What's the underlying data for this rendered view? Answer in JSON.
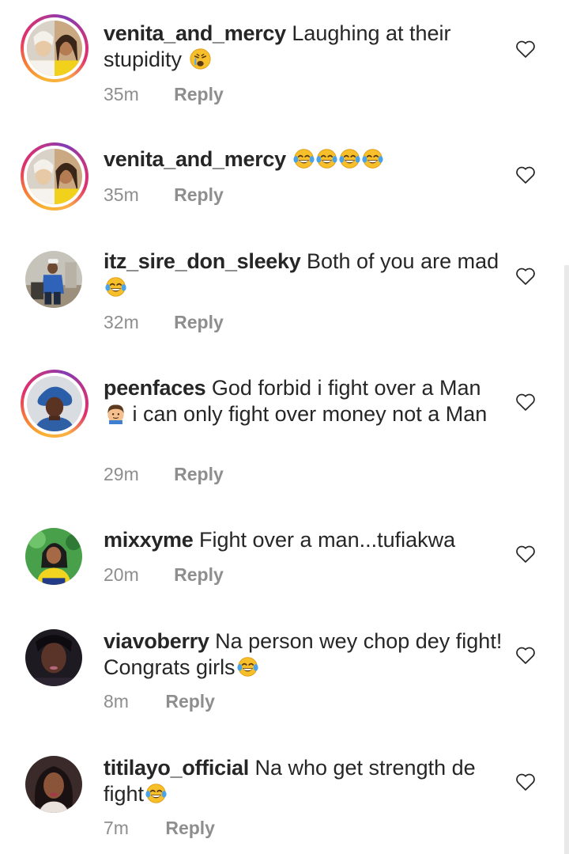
{
  "comments": [
    {
      "username": "venita_and_mercy",
      "text": "Laughing at their stupidity",
      "emoji": "weary-face",
      "time": "35m",
      "reply_label": "Reply",
      "avatar": "duo-women",
      "has_story": true
    },
    {
      "username": "venita_and_mercy",
      "text": "",
      "emoji": "tears-of-joy-x4",
      "time": "35m",
      "reply_label": "Reply",
      "avatar": "duo-women",
      "has_story": true
    },
    {
      "username": "itz_sire_don_sleeky",
      "text": "Both of you are mad",
      "emoji": "tears-of-joy",
      "time": "32m",
      "reply_label": "Reply",
      "avatar": "man-outdoors",
      "has_story": false
    },
    {
      "username": "peenfaces",
      "text_before_emoji": "God forbid i fight over a Man",
      "emoji": "man-face",
      "text": "i can only fight over money not a Man",
      "time": "29m",
      "reply_label": "Reply",
      "avatar": "woman-blue-headwrap",
      "has_story": true
    },
    {
      "username": "mixxyme",
      "text": "Fight over a man...tufiakwa",
      "time": "20m",
      "reply_label": "Reply",
      "avatar": "woman-yellow-top",
      "has_story": false
    },
    {
      "username": "viavoberry",
      "text": "Na person wey chop dey fight! Congrats girls",
      "emoji": "tears-of-joy",
      "time": "8m",
      "reply_label": "Reply",
      "avatar": "woman-dark",
      "has_story": false
    },
    {
      "username": "titilayo_official",
      "text": "Na who get strength de fight",
      "emoji": "tears-of-joy",
      "time": "7m",
      "reply_label": "Reply",
      "avatar": "woman-portrait",
      "has_story": false
    }
  ],
  "icons": {
    "like": "heart-outline-icon"
  },
  "colors": {
    "text": "#262626",
    "secondary": "#8e8e8e",
    "story_ring": "#e1306c"
  }
}
